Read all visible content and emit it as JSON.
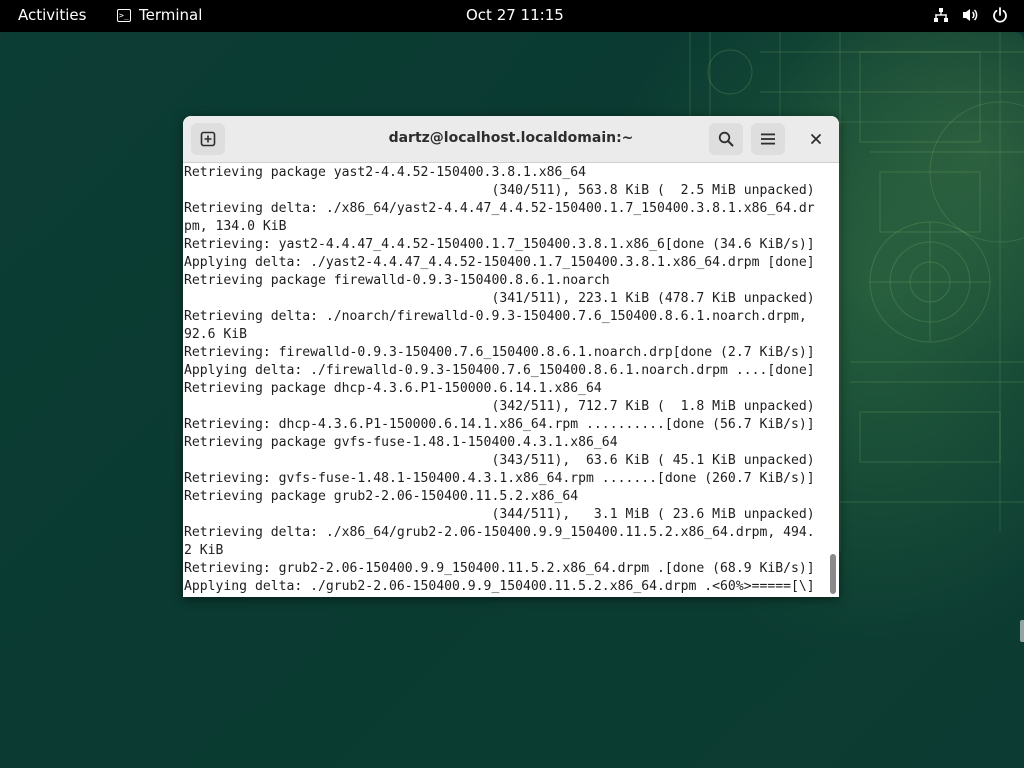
{
  "topbar": {
    "activities": "Activities",
    "app_name": "Terminal",
    "app_icon": "terminal-icon",
    "clock": "Oct 27  11:15",
    "tray_icons": [
      "network-icon",
      "volume-icon",
      "power-icon"
    ]
  },
  "window": {
    "title": "dartz@localhost.localdomain:~",
    "buttons": {
      "new_tab": "new-tab-icon",
      "search": "search-icon",
      "menu": "hamburger-menu-icon",
      "close": "close-icon"
    }
  },
  "terminal": {
    "lines": [
      "Retrieving package yast2-4.4.52-150400.3.8.1.x86_64",
      "                                       (340/511), 563.8 KiB (  2.5 MiB unpacked)",
      "Retrieving delta: ./x86_64/yast2-4.4.47_4.4.52-150400.1.7_150400.3.8.1.x86_64.dr",
      "pm, 134.0 KiB",
      "Retrieving: yast2-4.4.47_4.4.52-150400.1.7_150400.3.8.1.x86_6[done (34.6 KiB/s)]",
      "Applying delta: ./yast2-4.4.47_4.4.52-150400.1.7_150400.3.8.1.x86_64.drpm [done]",
      "Retrieving package firewalld-0.9.3-150400.8.6.1.noarch",
      "                                       (341/511), 223.1 KiB (478.7 KiB unpacked)",
      "Retrieving delta: ./noarch/firewalld-0.9.3-150400.7.6_150400.8.6.1.noarch.drpm,",
      "92.6 KiB",
      "Retrieving: firewalld-0.9.3-150400.7.6_150400.8.6.1.noarch.drp[done (2.7 KiB/s)]",
      "Applying delta: ./firewalld-0.9.3-150400.7.6_150400.8.6.1.noarch.drpm ....[done]",
      "Retrieving package dhcp-4.3.6.P1-150000.6.14.1.x86_64",
      "                                       (342/511), 712.7 KiB (  1.8 MiB unpacked)",
      "Retrieving: dhcp-4.3.6.P1-150000.6.14.1.x86_64.rpm ..........[done (56.7 KiB/s)]",
      "Retrieving package gvfs-fuse-1.48.1-150400.4.3.1.x86_64",
      "                                       (343/511),  63.6 KiB ( 45.1 KiB unpacked)",
      "Retrieving: gvfs-fuse-1.48.1-150400.4.3.1.x86_64.rpm .......[done (260.7 KiB/s)]",
      "Retrieving package grub2-2.06-150400.11.5.2.x86_64",
      "                                       (344/511),   3.1 MiB ( 23.6 MiB unpacked)",
      "Retrieving delta: ./x86_64/grub2-2.06-150400.9.9_150400.11.5.2.x86_64.drpm, 494.",
      "2 KiB",
      "Retrieving: grub2-2.06-150400.9.9_150400.11.5.2.x86_64.drpm .[done (68.9 KiB/s)]",
      "Applying delta: ./grub2-2.06-150400.9.9_150400.11.5.2.x86_64.drpm .<60%>=====[\\]"
    ]
  },
  "colors": {
    "wallpaper": "#0e3a32",
    "topbar": "#000000",
    "headerbar": "#ebebeb",
    "terminal_bg": "#ffffff",
    "terminal_fg": "#1e1e1e"
  }
}
